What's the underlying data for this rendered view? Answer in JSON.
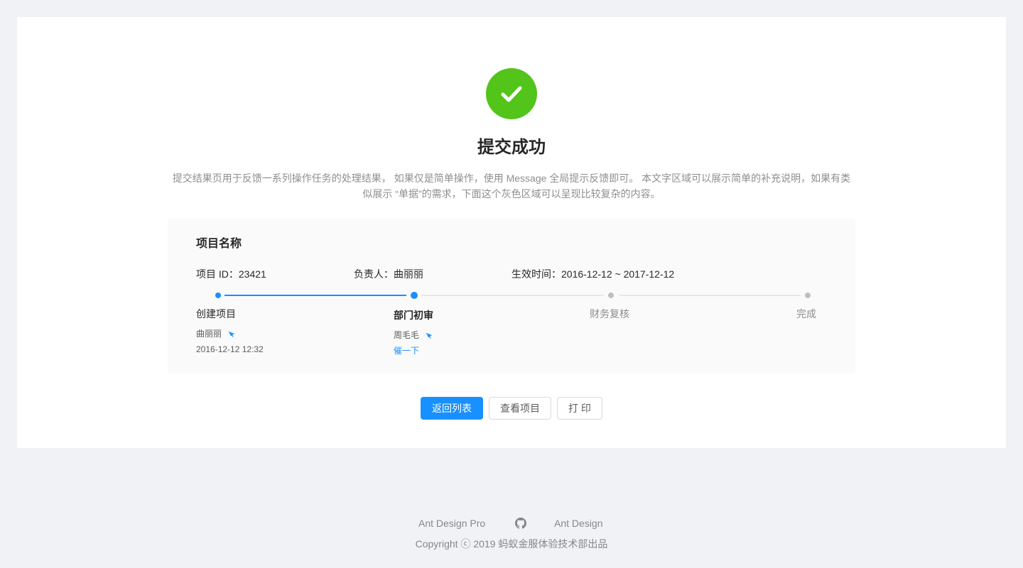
{
  "result": {
    "status": "success",
    "status_icon": "check-circle-icon",
    "status_color": "#52c41a",
    "title": "提交成功",
    "description": "提交结果页用于反馈一系列操作任务的处理结果， 如果仅是简单操作，使用 Message 全局提示反馈即可。 本文字区域可以展示简单的补充说明，如果有类似展示 “单据”的需求，下面这个灰色区域可以呈现比较复杂的内容。"
  },
  "project": {
    "name": "项目名称",
    "id_text": "项目 ID：23421",
    "owner_text": "负责人：曲丽丽",
    "time_text": "生效时间：2016-12-12 ~ 2017-12-12"
  },
  "steps": [
    {
      "title": "创建项目",
      "status": "finished",
      "user": "曲丽丽",
      "time": "2016-12-12 12:32"
    },
    {
      "title": "部门初审",
      "status": "current",
      "user": "周毛毛",
      "action": "催一下"
    },
    {
      "title": "财务复核",
      "status": "wait"
    },
    {
      "title": "完成",
      "status": "wait"
    }
  ],
  "actions": {
    "back": "返回列表",
    "view": "查看项目",
    "print": "打 印"
  },
  "footer": {
    "link_pro": "Ant Design Pro",
    "link_github_icon": "github-icon",
    "link_antd": "Ant Design",
    "copyright": "Copyright ⓒ 2019 蚂蚁金服体验技术部出品"
  },
  "colors": {
    "primary": "#1890ff",
    "success": "#52c41a",
    "background": "#f0f2f5",
    "panel": "#fafafa"
  }
}
